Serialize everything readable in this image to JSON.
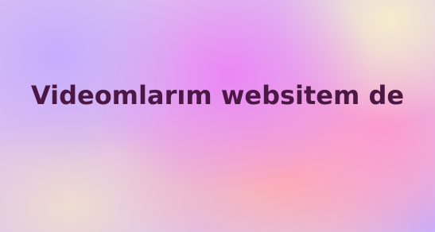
{
  "headline": "Videomlarım websitem de",
  "colors": {
    "text": "#4b1744",
    "gradient_lavender": "#c4acff",
    "gradient_pink": "#ec82f5",
    "gradient_peach": "#ffafac",
    "gradient_cream": "#f6eccc"
  }
}
